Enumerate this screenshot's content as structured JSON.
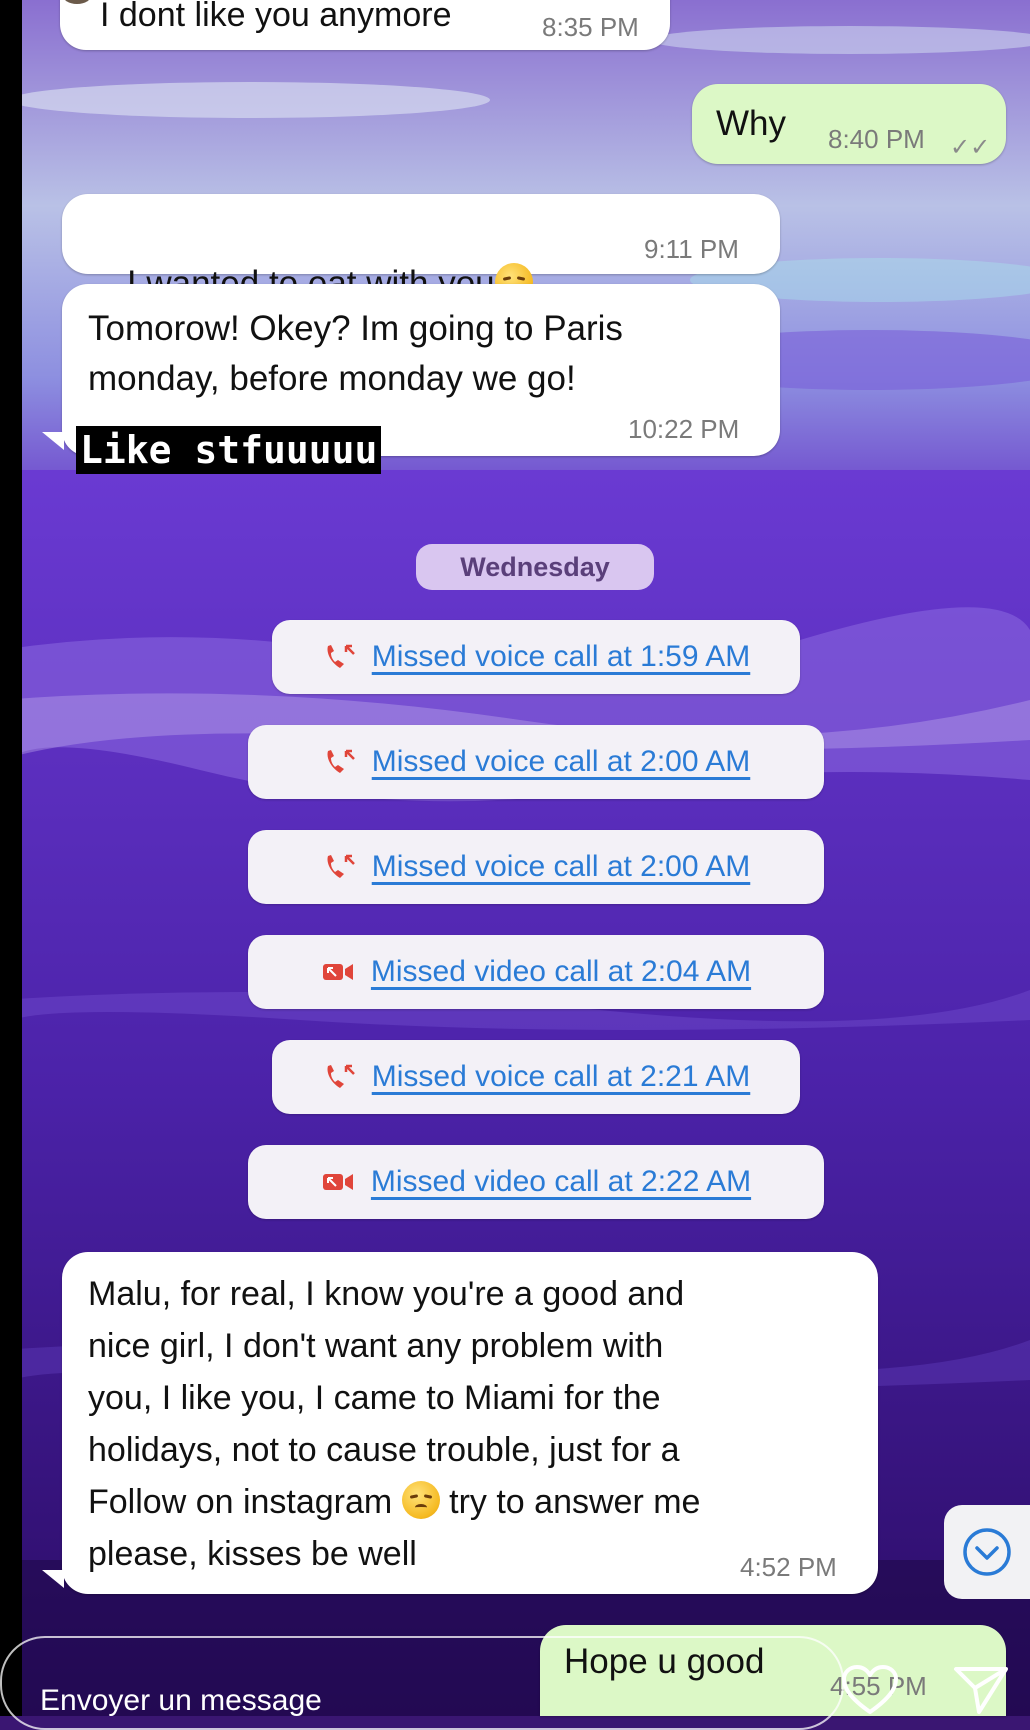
{
  "messages": {
    "m1": {
      "text": "I dont like you anymore",
      "time": "8:35 PM"
    },
    "m2": {
      "text": "Why",
      "time": "8:40 PM"
    },
    "m3": {
      "text": "I wanted to eat with you",
      "time": "9:11 PM"
    },
    "m4": {
      "text": "Tomorow! Okey? Im going to Paris\nmonday, before monday we go!",
      "time": "10:22 PM"
    },
    "m5": {
      "text": "Malu, for real, I know you're a good and\nnice girl, I don't want any problem with\nyou, I like you, I came to Miami for the\nholidays, not to cause trouble, just for a\nFollow on instagram",
      "text_after": " try to answer me\nplease, kisses be well",
      "time": "4:52 PM"
    },
    "m6": {
      "text": "Hope u good",
      "time": "4:55 PM"
    }
  },
  "sticker": "Like stfuuuuu",
  "day_chip": "Wednesday",
  "calls": [
    {
      "type": "voice",
      "label": "Missed voice call at 1:59 AM"
    },
    {
      "type": "voice",
      "label": "Missed voice call at 2:00 AM"
    },
    {
      "type": "voice",
      "label": "Missed voice call at 2:00 AM"
    },
    {
      "type": "video",
      "label": "Missed video call at 2:04 AM"
    },
    {
      "type": "voice",
      "label": "Missed voice call at 2:21 AM"
    },
    {
      "type": "video",
      "label": "Missed video call at 2:22 AM"
    }
  ],
  "composer": {
    "placeholder": "Envoyer un message"
  },
  "icons": {
    "scroll_down": "chevron-down-circle-icon",
    "like": "heart-icon",
    "send": "send-icon",
    "missed_voice": "missed-voice-call-icon",
    "missed_video": "missed-video-call-icon"
  },
  "colors": {
    "bubble_in": "#ffffff",
    "bubble_out": "#dcf8c6",
    "link": "#2a7bd6",
    "missed": "#e0453a",
    "day_chip": "#d9c6f0"
  }
}
